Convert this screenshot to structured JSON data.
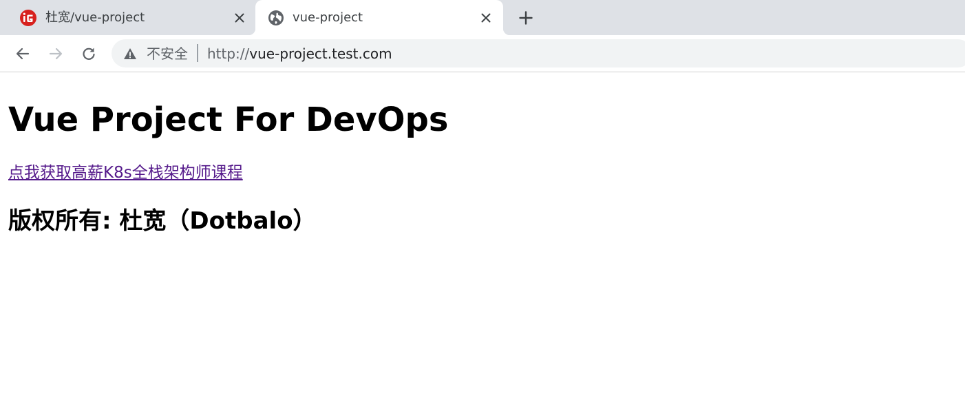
{
  "browser": {
    "tabs": [
      {
        "title": "杜宽/vue-project",
        "favicon": "gitee-logo-icon",
        "active": false
      },
      {
        "title": "vue-project",
        "favicon": "globe-icon",
        "active": true
      }
    ],
    "new_tab_icon": "plus-icon",
    "nav": {
      "back_icon": "arrow-left-icon",
      "forward_icon": "arrow-right-icon",
      "reload_icon": "reload-icon"
    },
    "omnibox": {
      "security_icon": "warning-triangle-icon",
      "security_label": "不安全",
      "url_scheme": "http://",
      "url_host": "vue-project.test.com"
    }
  },
  "page": {
    "heading": "Vue Project For DevOps",
    "link_text": "点我获取高薪K8s全栈架构师课程",
    "copyright": "版权所有: 杜宽（Dotbalo）"
  },
  "colors": {
    "tabstrip_bg": "#dee1e6",
    "omnibox_bg": "#f1f3f4",
    "visited_link": "#551a8b",
    "favicon_red": "#d7211e"
  }
}
